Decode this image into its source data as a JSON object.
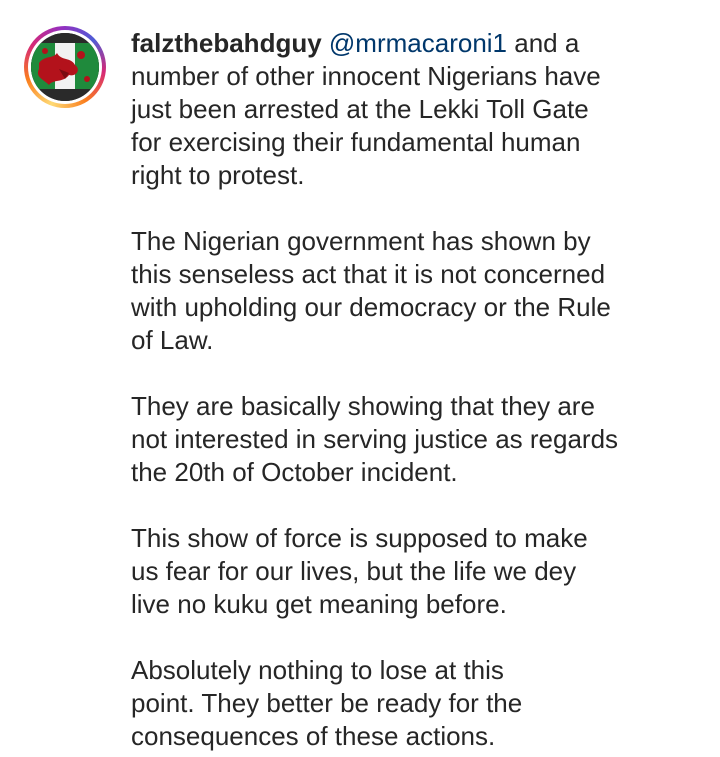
{
  "post": {
    "username": "falzthebahdguy",
    "mention": "@mrmacaroni1",
    "avatar_icon": "profile-picture-green-white-flag-red-splatter",
    "paragraphs": [
      "and a\nnumber of other innocent Nigerians have\njust been arrested at the Lekki Toll Gate\nfor exercising their fundamental human\nright to protest.",
      "The Nigerian government has shown by\nthis senseless act that it is not concerned\nwith upholding our democracy or the Rule\nof Law.",
      "They are basically showing that they are\nnot interested in serving justice as regards\nthe 20th of October incident.",
      "This show of force is supposed to make\nus fear for our lives, but the life we dey\nlive no kuku get meaning before.",
      "Absolutely nothing to lose at this\npoint. They better be ready for the\nconsequences of these actions."
    ]
  },
  "colors": {
    "text": "#262626",
    "mention": "#00376b",
    "flag_green": "#1f8a3c",
    "splatter_red": "#b3121b"
  }
}
